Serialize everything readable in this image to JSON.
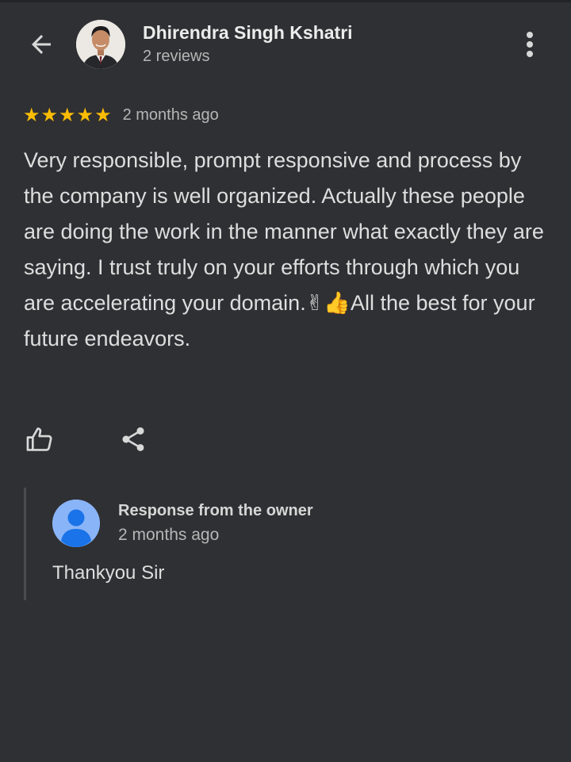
{
  "colors": {
    "background": "#2f3033",
    "star": "#fbbc04",
    "owner_avatar": "#8ab4f8",
    "text_primary": "#ececec",
    "text_secondary": "#b6b6b6"
  },
  "header": {
    "back_icon": "arrow-back-icon",
    "avatar_icon": "reviewer-photo",
    "reviewer_name": "Dhirendra Singh Kshatri",
    "reviewer_meta": "2 reviews",
    "more_icon": "more-vert-icon"
  },
  "review": {
    "rating": 5,
    "stars": [
      "★",
      "★",
      "★",
      "★",
      "★"
    ],
    "time": "2 months ago",
    "text_part1": "Very responsible, prompt responsive and process by the company is well organized. Actually these people are doing the work in the manner what exactly they are saying. I trust truly on your efforts through which you are accelerating your domain.",
    "emoji_victory": "✌",
    "emoji_thumbs": "👍",
    "text_part2": "All the best for your future endeavors."
  },
  "actions": {
    "like_icon": "thumb-up-icon",
    "share_icon": "share-icon"
  },
  "owner_response": {
    "avatar_icon": "person-icon",
    "title": "Response from the owner",
    "time": "2 months ago",
    "reply": "Thankyou Sir"
  }
}
